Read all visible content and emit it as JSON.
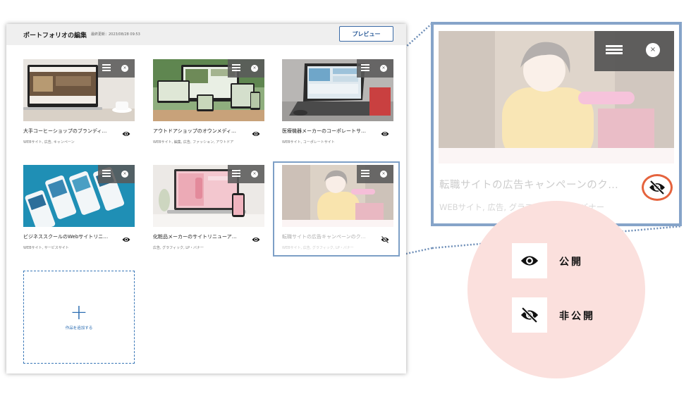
{
  "editor": {
    "title": "ポートフォリオの編集",
    "last_updated": "最終更新：2023/08/28 09:53",
    "preview_label": "プレビュー"
  },
  "works": [
    {
      "title": "大手コーヒーショップのブランディ…",
      "tags": "WEBサイト, 広告, キャンペーン",
      "visibility": "public"
    },
    {
      "title": "アウトドアショップのオウンメディ…",
      "tags": "WEBサイト, 編集, 広告, ファッション, アウトドア",
      "visibility": "public"
    },
    {
      "title": "医療機器メーカーのコーポレートサ…",
      "tags": "WEBサイト, コーポレートサイト",
      "visibility": "public"
    },
    {
      "title": "ビジネススクールのWebサイトリニ…",
      "tags": "WEBサイト, サービスサイト",
      "visibility": "public"
    },
    {
      "title": "化粧品メーカーのサイトリニューア…",
      "tags": "広告, グラフィック, LP・バナー",
      "visibility": "public"
    },
    {
      "title": "転職サイトの広告キャンペーンのク…",
      "tags": "WEBサイト, 広告, グラフィック, LP・バナー",
      "visibility": "private"
    }
  ],
  "add_work_label": "作品を追加する",
  "zoom": {
    "title": "転職サイトの広告キャンペーンのク…",
    "tags": "WEBサイト, 広告, グラフィック, LP・バナー"
  },
  "legend": {
    "public_label": "公開",
    "private_label": "非公開"
  },
  "colors": {
    "accent": "#2c5c99",
    "highlight_border": "#86a4c9",
    "hidden_ring": "#e5633d",
    "legend_bg": "#fbe0dd"
  },
  "icons": {
    "public": "eye-icon",
    "private": "eye-slash-icon",
    "menu": "menu-icon",
    "close": "close-icon",
    "add": "plus-icon"
  }
}
